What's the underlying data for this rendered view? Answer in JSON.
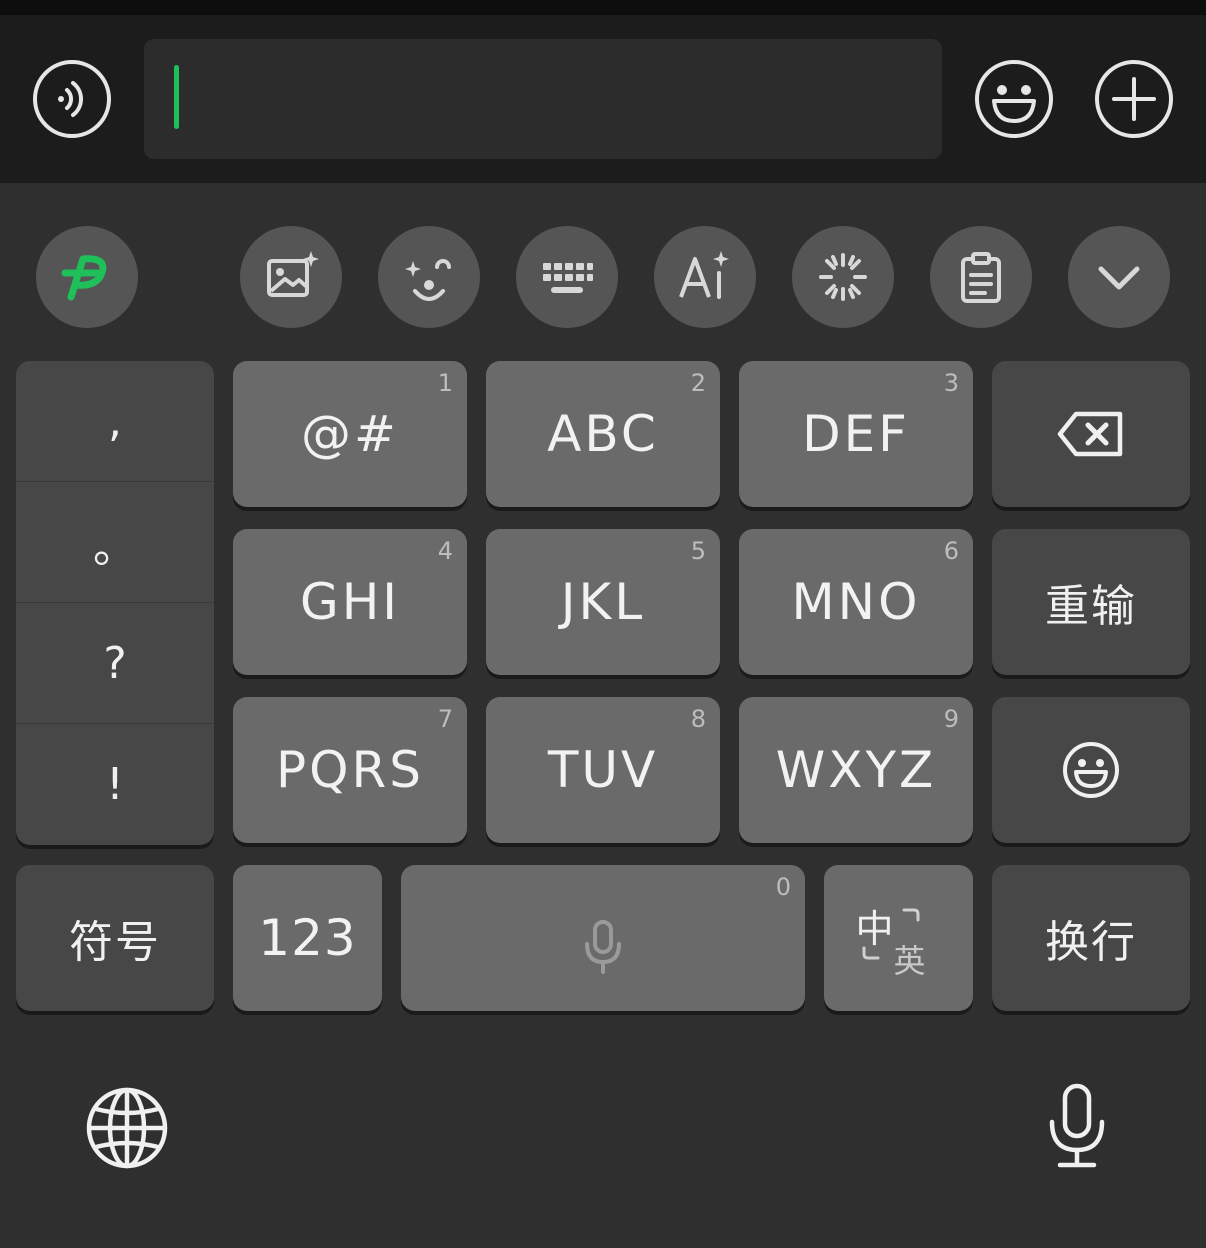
{
  "keys": {
    "k1": {
      "label": "@#",
      "num": "1"
    },
    "k2": {
      "label": "ABC",
      "num": "2"
    },
    "k3": {
      "label": "DEF",
      "num": "3"
    },
    "k4": {
      "label": "GHI",
      "num": "4"
    },
    "k5": {
      "label": "JKL",
      "num": "5"
    },
    "k6": {
      "label": "MNO",
      "num": "6"
    },
    "k7": {
      "label": "PQRS",
      "num": "7"
    },
    "k8": {
      "label": "TUV",
      "num": "8"
    },
    "k9": {
      "label": "WXYZ",
      "num": "9"
    },
    "space": {
      "num": "0"
    }
  },
  "punctuation": [
    ",",
    "。",
    "?",
    "!"
  ],
  "function_keys": {
    "reset": "重输",
    "symbols": "符号",
    "numbers": "123",
    "lang_cn": "中",
    "lang_en": "英",
    "newline": "换行"
  },
  "toolbar_icons": [
    "logo-icon",
    "ai-image-icon",
    "sticker-icon",
    "keyboard-icon",
    "ai-text-icon",
    "loading-icon",
    "clipboard-icon",
    "collapse-icon"
  ],
  "colors": {
    "accent_green": "#1fbf5a",
    "key_light": "#6a6a6a",
    "key_dark": "#474747",
    "background": "#2f2f2f"
  }
}
